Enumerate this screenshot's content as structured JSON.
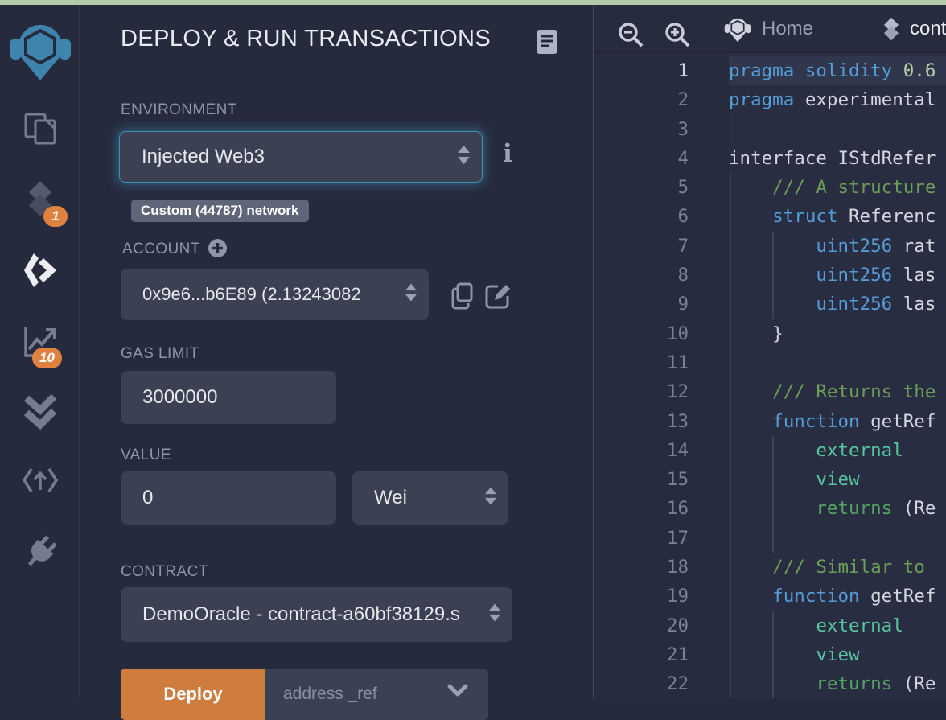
{
  "window": {
    "top_strip_color": "#b5cba8"
  },
  "activity_bar": {
    "compiler_badge": "1",
    "analytics_badge": "10"
  },
  "panel": {
    "title": "DEPLOY & RUN TRANSACTIONS",
    "environment_label": "ENVIRONMENT",
    "environment_value": "Injected Web3",
    "network_badge": "Custom (44787) network",
    "account_label": "ACCOUNT",
    "account_value": "0x9e6...b6E89 (2.13243082",
    "gas_label": "GAS LIMIT",
    "gas_value": "3000000",
    "value_label": "VALUE",
    "value_amount": "0",
    "value_unit": "Wei",
    "contract_label": "CONTRACT",
    "contract_value": "DemoOracle - contract-a60bf38129.s",
    "deploy_button": "Deploy",
    "deploy_placeholder": "address _ref",
    "info_glyph": "i"
  },
  "editor": {
    "tab_home": "Home",
    "tab_file": "contr",
    "lines": [
      {
        "n": "1",
        "hl": true,
        "toks": [
          [
            "k",
            "pragma"
          ],
          [
            "p",
            " "
          ],
          [
            "k",
            "solidity"
          ],
          [
            "p",
            " "
          ],
          [
            "n",
            "0.6"
          ]
        ]
      },
      {
        "n": "2",
        "toks": [
          [
            "k",
            "pragma"
          ],
          [
            "p",
            " experimental"
          ]
        ]
      },
      {
        "n": "3",
        "toks": []
      },
      {
        "n": "4",
        "toks": [
          [
            "p",
            "interface IStdRefer"
          ]
        ]
      },
      {
        "n": "5",
        "toks": [
          [
            "c",
            "    /// A structure"
          ]
        ]
      },
      {
        "n": "6",
        "toks": [
          [
            "p",
            "    "
          ],
          [
            "k",
            "struct"
          ],
          [
            "p",
            " Referenc"
          ]
        ]
      },
      {
        "n": "7",
        "toks": [
          [
            "p",
            "        "
          ],
          [
            "k",
            "uint256"
          ],
          [
            "p",
            " rat"
          ]
        ]
      },
      {
        "n": "8",
        "toks": [
          [
            "p",
            "        "
          ],
          [
            "k",
            "uint256"
          ],
          [
            "p",
            " las"
          ]
        ]
      },
      {
        "n": "9",
        "toks": [
          [
            "p",
            "        "
          ],
          [
            "k",
            "uint256"
          ],
          [
            "p",
            " las"
          ]
        ]
      },
      {
        "n": "10",
        "toks": [
          [
            "p",
            "    }"
          ]
        ]
      },
      {
        "n": "11",
        "toks": []
      },
      {
        "n": "12",
        "toks": [
          [
            "c",
            "    /// Returns the"
          ]
        ]
      },
      {
        "n": "13",
        "toks": [
          [
            "p",
            "    "
          ],
          [
            "k",
            "function"
          ],
          [
            "p",
            " getRef"
          ]
        ]
      },
      {
        "n": "14",
        "toks": [
          [
            "p",
            "        "
          ],
          [
            "t",
            "external"
          ]
        ]
      },
      {
        "n": "15",
        "toks": [
          [
            "p",
            "        "
          ],
          [
            "t",
            "view"
          ]
        ]
      },
      {
        "n": "16",
        "toks": [
          [
            "p",
            "        "
          ],
          [
            "g",
            "returns"
          ],
          [
            "p",
            " (Re"
          ]
        ]
      },
      {
        "n": "17",
        "toks": []
      },
      {
        "n": "18",
        "toks": [
          [
            "c",
            "    /// Similar to"
          ]
        ]
      },
      {
        "n": "19",
        "toks": [
          [
            "p",
            "    "
          ],
          [
            "k",
            "function"
          ],
          [
            "p",
            " getRef"
          ]
        ]
      },
      {
        "n": "20",
        "toks": [
          [
            "p",
            "        "
          ],
          [
            "t",
            "external"
          ]
        ]
      },
      {
        "n": "21",
        "toks": [
          [
            "p",
            "        "
          ],
          [
            "t",
            "view"
          ]
        ]
      },
      {
        "n": "22",
        "toks": [
          [
            "p",
            "        "
          ],
          [
            "g",
            "returns"
          ],
          [
            "p",
            " (Re"
          ]
        ]
      }
    ]
  }
}
